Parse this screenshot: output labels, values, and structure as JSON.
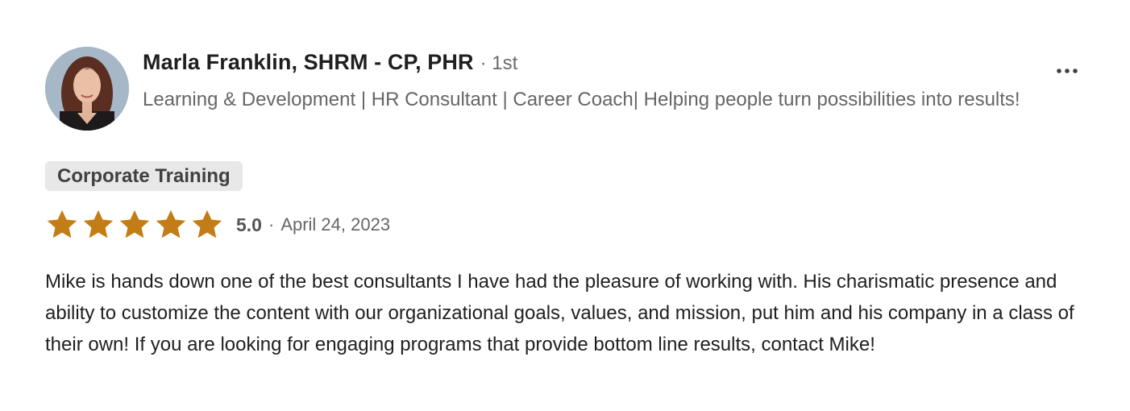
{
  "reviewer": {
    "name": "Marla Franklin, SHRM - CP, PHR",
    "degree": "· 1st",
    "headline": "Learning & Development | HR Consultant | Career Coach| Helping people turn possibilities into results!"
  },
  "service": {
    "tag": "Corporate Training"
  },
  "rating": {
    "score": "5.0",
    "separator": "·",
    "date": "April 24, 2023",
    "stars": 5,
    "star_color": "#c37d16"
  },
  "review": {
    "text": "Mike is hands down one of the best consultants I have had the pleasure of working with. His charismatic presence and ability to customize the content with our organizational goals, values, and mission, put him and his company in a class of their own! If you are looking for engaging programs that provide bottom line results, contact Mike!"
  },
  "menu": {
    "icon": "more-horizontal-icon"
  }
}
